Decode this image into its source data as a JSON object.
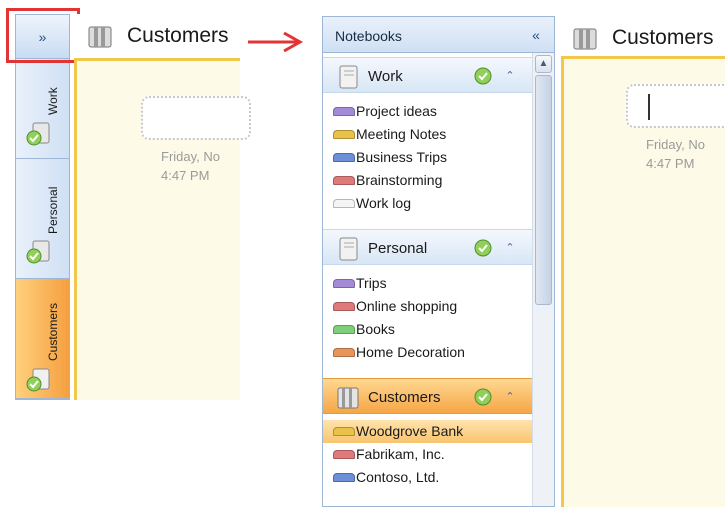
{
  "collapsed": {
    "expand_label": "»",
    "tabs": [
      {
        "label": "Work"
      },
      {
        "label": "Personal"
      },
      {
        "label": "Customers"
      }
    ],
    "page_title": "Customers",
    "date_text": "Friday, No",
    "time_text": "4:47 PM"
  },
  "expanded": {
    "header_title": "Notebooks",
    "collapse_label": "«",
    "sections": [
      {
        "name": "Work",
        "pages": [
          {
            "label": "Project ideas",
            "color": "#a58ad8"
          },
          {
            "label": "Meeting Notes",
            "color": "#e8c24a"
          },
          {
            "label": "Business Trips",
            "color": "#6d8fd8"
          },
          {
            "label": "Brainstorming",
            "color": "#e07a7a"
          },
          {
            "label": "Work log",
            "color": "#f4f4f4"
          }
        ]
      },
      {
        "name": "Personal",
        "pages": [
          {
            "label": "Trips",
            "color": "#a58ad8"
          },
          {
            "label": "Online shopping",
            "color": "#e07a7a"
          },
          {
            "label": "Books",
            "color": "#7fcf7a"
          },
          {
            "label": "Home Decoration",
            "color": "#e8945a"
          }
        ]
      },
      {
        "name": "Customers",
        "pages": [
          {
            "label": "Woodgrove Bank",
            "color": "#e8c24a",
            "selected": true
          },
          {
            "label": "Fabrikam, Inc.",
            "color": "#e07a7a"
          },
          {
            "label": "Contoso, Ltd.",
            "color": "#6d8fd8"
          }
        ]
      }
    ],
    "page_title": "Customers",
    "date_text": "Friday, No",
    "time_text": "4:47 PM"
  },
  "colors": {
    "highlight": "#e23434",
    "arrow": "#e23434",
    "active_tab": "#f5a040",
    "page_border": "#f2c84b"
  }
}
